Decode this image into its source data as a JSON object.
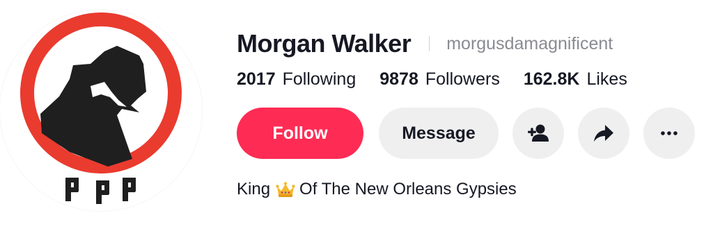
{
  "profile": {
    "display_name": "Morgan Walker",
    "username": "morgusdamagnificent",
    "avatar_text": "PPP",
    "avatar_icon": "no-entry-sign-with-figure"
  },
  "stats": [
    {
      "value": "2017",
      "label": "Following"
    },
    {
      "value": "9878",
      "label": "Followers"
    },
    {
      "value": "162.8K",
      "label": "Likes"
    }
  ],
  "actions": {
    "follow_label": "Follow",
    "message_label": "Message",
    "add_friend_icon": "add-person-icon",
    "share_icon": "share-arrow-icon",
    "more_icon": "more-dots-icon"
  },
  "bio": {
    "before_emoji": "King",
    "emoji": "crown",
    "after_emoji": "Of The New Orleans Gypsies"
  },
  "colors": {
    "follow_button": "#fe2c55",
    "secondary_button": "#efeff0",
    "primary_text": "#161823",
    "secondary_text": "#8a8b91",
    "avatar_ring": "#ea3b2f"
  }
}
